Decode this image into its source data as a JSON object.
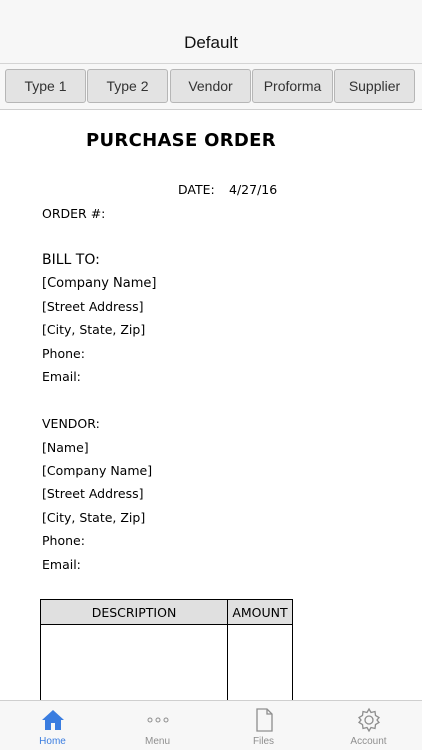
{
  "navbar": {
    "title": "Default"
  },
  "segments": [
    "Type 1",
    "Type 2",
    "Vendor",
    "Proforma",
    "Supplier"
  ],
  "document": {
    "heading": "PURCHASE ORDER",
    "date_label": "DATE:",
    "date_value": "4/27/16",
    "order_label": "ORDER #:",
    "bill_to": {
      "label": "BILL TO:",
      "company": "[Company Name]",
      "street": "[Street Address]",
      "city": "[City, State,  Zip]",
      "phone": "Phone:",
      "email": "Email:"
    },
    "vendor": {
      "label": "VENDOR:",
      "name": "[Name]",
      "company": "[Company Name]",
      "street": "[Street Address]",
      "city": "[City, State,  Zip]",
      "phone": "Phone:",
      "email": "Email:"
    },
    "table": {
      "description_header": "DESCRIPTION",
      "amount_header": "AMOUNT"
    }
  },
  "tabs": [
    {
      "label": "Home",
      "icon": "home-icon",
      "active": true
    },
    {
      "label": "Menu",
      "icon": "more-icon",
      "active": false
    },
    {
      "label": "Files",
      "icon": "file-icon",
      "active": false
    },
    {
      "label": "Account",
      "icon": "gear-icon",
      "active": false
    }
  ],
  "colors": {
    "accent": "#3a7de0",
    "inactive": "#8e8e8e"
  }
}
